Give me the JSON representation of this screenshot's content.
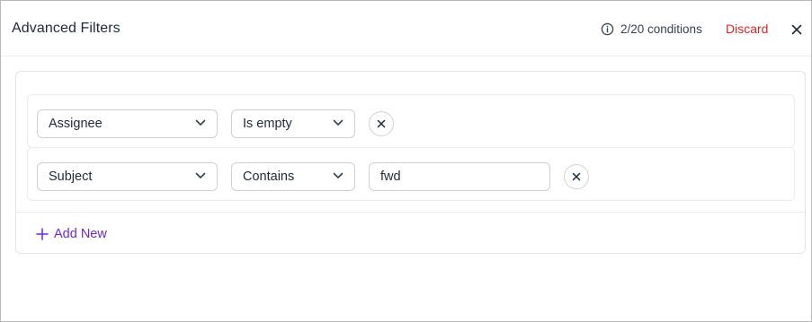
{
  "header": {
    "title": "Advanced Filters",
    "conditions_count": "2/20 conditions",
    "discard_label": "Discard"
  },
  "filters": [
    {
      "field": "Assignee",
      "operator": "Is empty",
      "value": null
    },
    {
      "field": "Subject",
      "operator": "Contains",
      "value": "fwd"
    }
  ],
  "add_new_label": "Add New",
  "icons": {
    "info": "info-icon",
    "close": "close-icon",
    "dropdown": "chevron-down-icon",
    "remove": "x-icon",
    "add": "plus-icon"
  },
  "colors": {
    "discard": "#dc2626",
    "accent": "#6d28d9",
    "border": "#cfcfd6"
  }
}
